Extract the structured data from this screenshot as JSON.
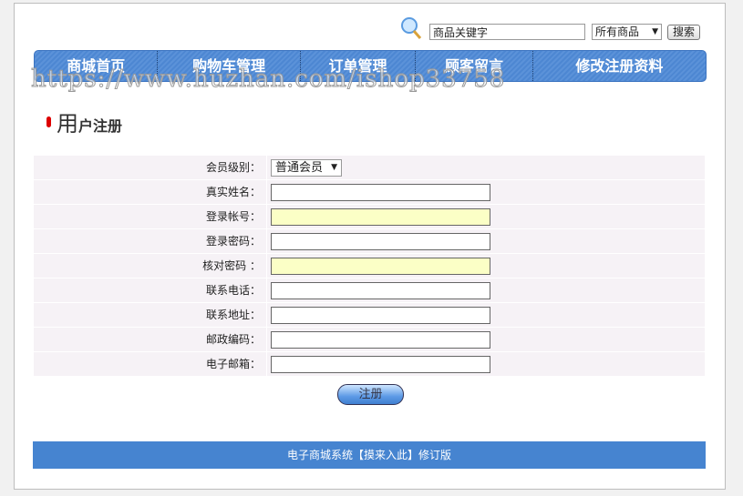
{
  "search": {
    "keyword_value": "商品关键字",
    "category_selected": "所有商品",
    "button_label": "搜索"
  },
  "nav": [
    "商城首页",
    "购物车管理",
    "订单管理",
    "顾客留言",
    "修改注册资料"
  ],
  "watermark": "https://www.huzhan.com/ishop33758",
  "page_title": {
    "first_char": "用",
    "rest": "户注册"
  },
  "form": {
    "fields": [
      {
        "label": "会员级别：",
        "type": "select",
        "value": "普通会员"
      },
      {
        "label": "真实姓名：",
        "type": "text",
        "value": ""
      },
      {
        "label": "登录帐号：",
        "type": "text",
        "value": "",
        "highlight": true
      },
      {
        "label": "登录密码：",
        "type": "password",
        "value": ""
      },
      {
        "label": "核对密码 ：",
        "type": "password",
        "value": "",
        "highlight": true
      },
      {
        "label": "联系电话：",
        "type": "text",
        "value": ""
      },
      {
        "label": "联系地址：",
        "type": "text",
        "value": ""
      },
      {
        "label": "邮政编码：",
        "type": "text",
        "value": ""
      },
      {
        "label": "电子邮箱：",
        "type": "text",
        "value": ""
      }
    ],
    "submit_label": "注册"
  },
  "footer": "电子商城系统【摸来入此】修订版",
  "colors": {
    "nav": "#4d87d2",
    "footer": "#4684d0",
    "highlight_input": "#fbffc6"
  }
}
